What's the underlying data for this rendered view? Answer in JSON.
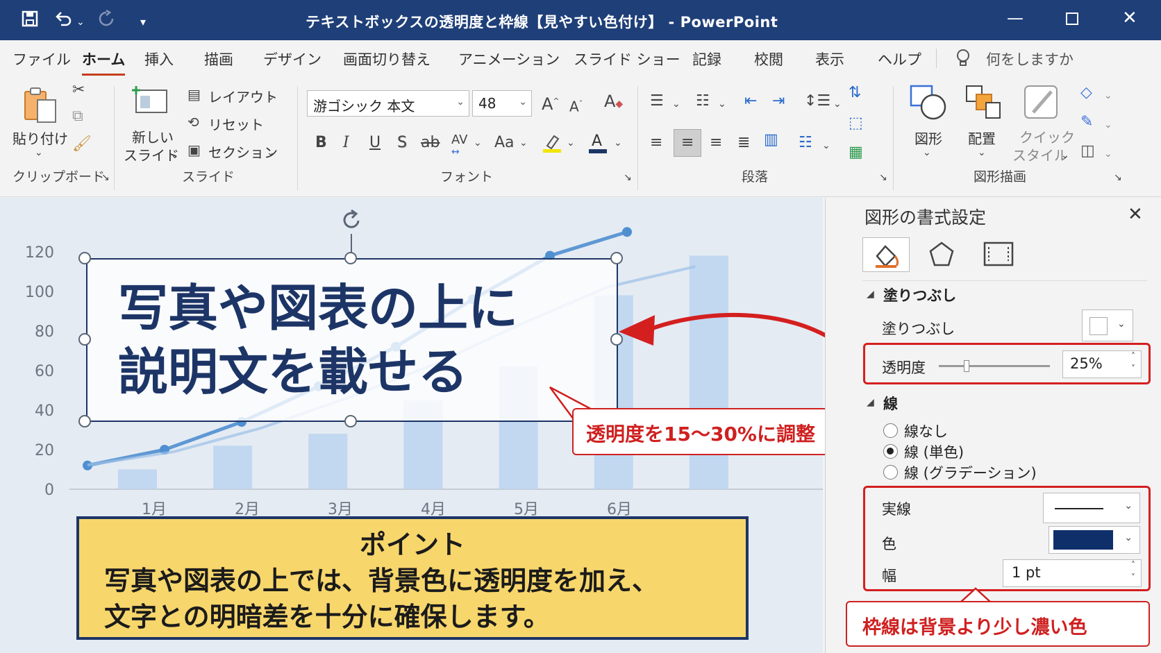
{
  "window": {
    "title": "テキストボックスの透明度と枠線【見やすい色付け】 - PowerPoint",
    "app": "PowerPoint"
  },
  "tabs": [
    "ファイル",
    "ホーム",
    "挿入",
    "描画",
    "デザイン",
    "画面切り替え",
    "アニメーション",
    "スライド ショー",
    "記録",
    "校閲",
    "表示",
    "ヘルプ"
  ],
  "active_tab": "ホーム",
  "tellme": "何をしますか",
  "ribbon": {
    "clipboard": {
      "paste": "貼り付け",
      "group": "クリップボード"
    },
    "slides": {
      "new_slide_1": "新しい",
      "new_slide_2": "スライド",
      "layout": "レイアウト",
      "reset": "リセット",
      "section": "セクション",
      "group": "スライド"
    },
    "font": {
      "name": "游ゴシック 本文",
      "size": "48",
      "group": "フォント",
      "bold": "B",
      "italic": "I",
      "underline": "U",
      "shadow": "S",
      "strike": "ab",
      "spacing": "AV",
      "case": "Aa",
      "grow": "A",
      "shrink": "A"
    },
    "paragraph": {
      "group": "段落"
    },
    "drawing": {
      "shapes": "図形",
      "arrange": "配置",
      "quick_1": "クイック",
      "quick_2": "スタイル",
      "group": "図形描画"
    }
  },
  "slide": {
    "headline_line1": "写真や図表の上に",
    "headline_line2": "説明文を載せる",
    "callout_transparency": "透明度を15〜30%に調整",
    "point_title": "ポイント",
    "point_line1": "写真や図表の上では、背景色に透明度を加え、",
    "point_line2": "文字との明暗差を十分に確保します。"
  },
  "chart_data": {
    "type": "bar",
    "categories": [
      "1月",
      "2月",
      "3月",
      "4月",
      "5月",
      "6月"
    ],
    "yticks": [
      "120",
      "100",
      "80",
      "60",
      "40",
      "20",
      "0"
    ],
    "ylim": [
      0,
      130
    ],
    "series": [
      {
        "values": [
          10,
          22,
          28,
          45,
          62,
          98,
          118
        ]
      },
      {
        "values": [
          12,
          20,
          34,
          52,
          72,
          96,
          118,
          130
        ]
      }
    ],
    "grid": false,
    "legend": "none"
  },
  "pane": {
    "title": "図形の書式設定",
    "fill_section": "塗りつぶし",
    "fill_label": "塗りつぶし",
    "transparency_label": "透明度",
    "transparency_value": "25%",
    "transparency_fraction": 0.25,
    "line_section": "線",
    "line_options": [
      "線なし",
      "線 (単色)",
      "線 (グラデーション)"
    ],
    "line_selected": 1,
    "dash_label": "実線",
    "color_label": "色",
    "width_label": "幅",
    "width_value": "1 pt",
    "line_color": "#0f2f6b",
    "callout_border": "枠線は背景より少し濃い色"
  },
  "colors": {
    "accent_red": "#d41f1f",
    "title_blue": "#1f3f78",
    "point_bg": "#f7d66c",
    "navy": "#1d3566"
  }
}
